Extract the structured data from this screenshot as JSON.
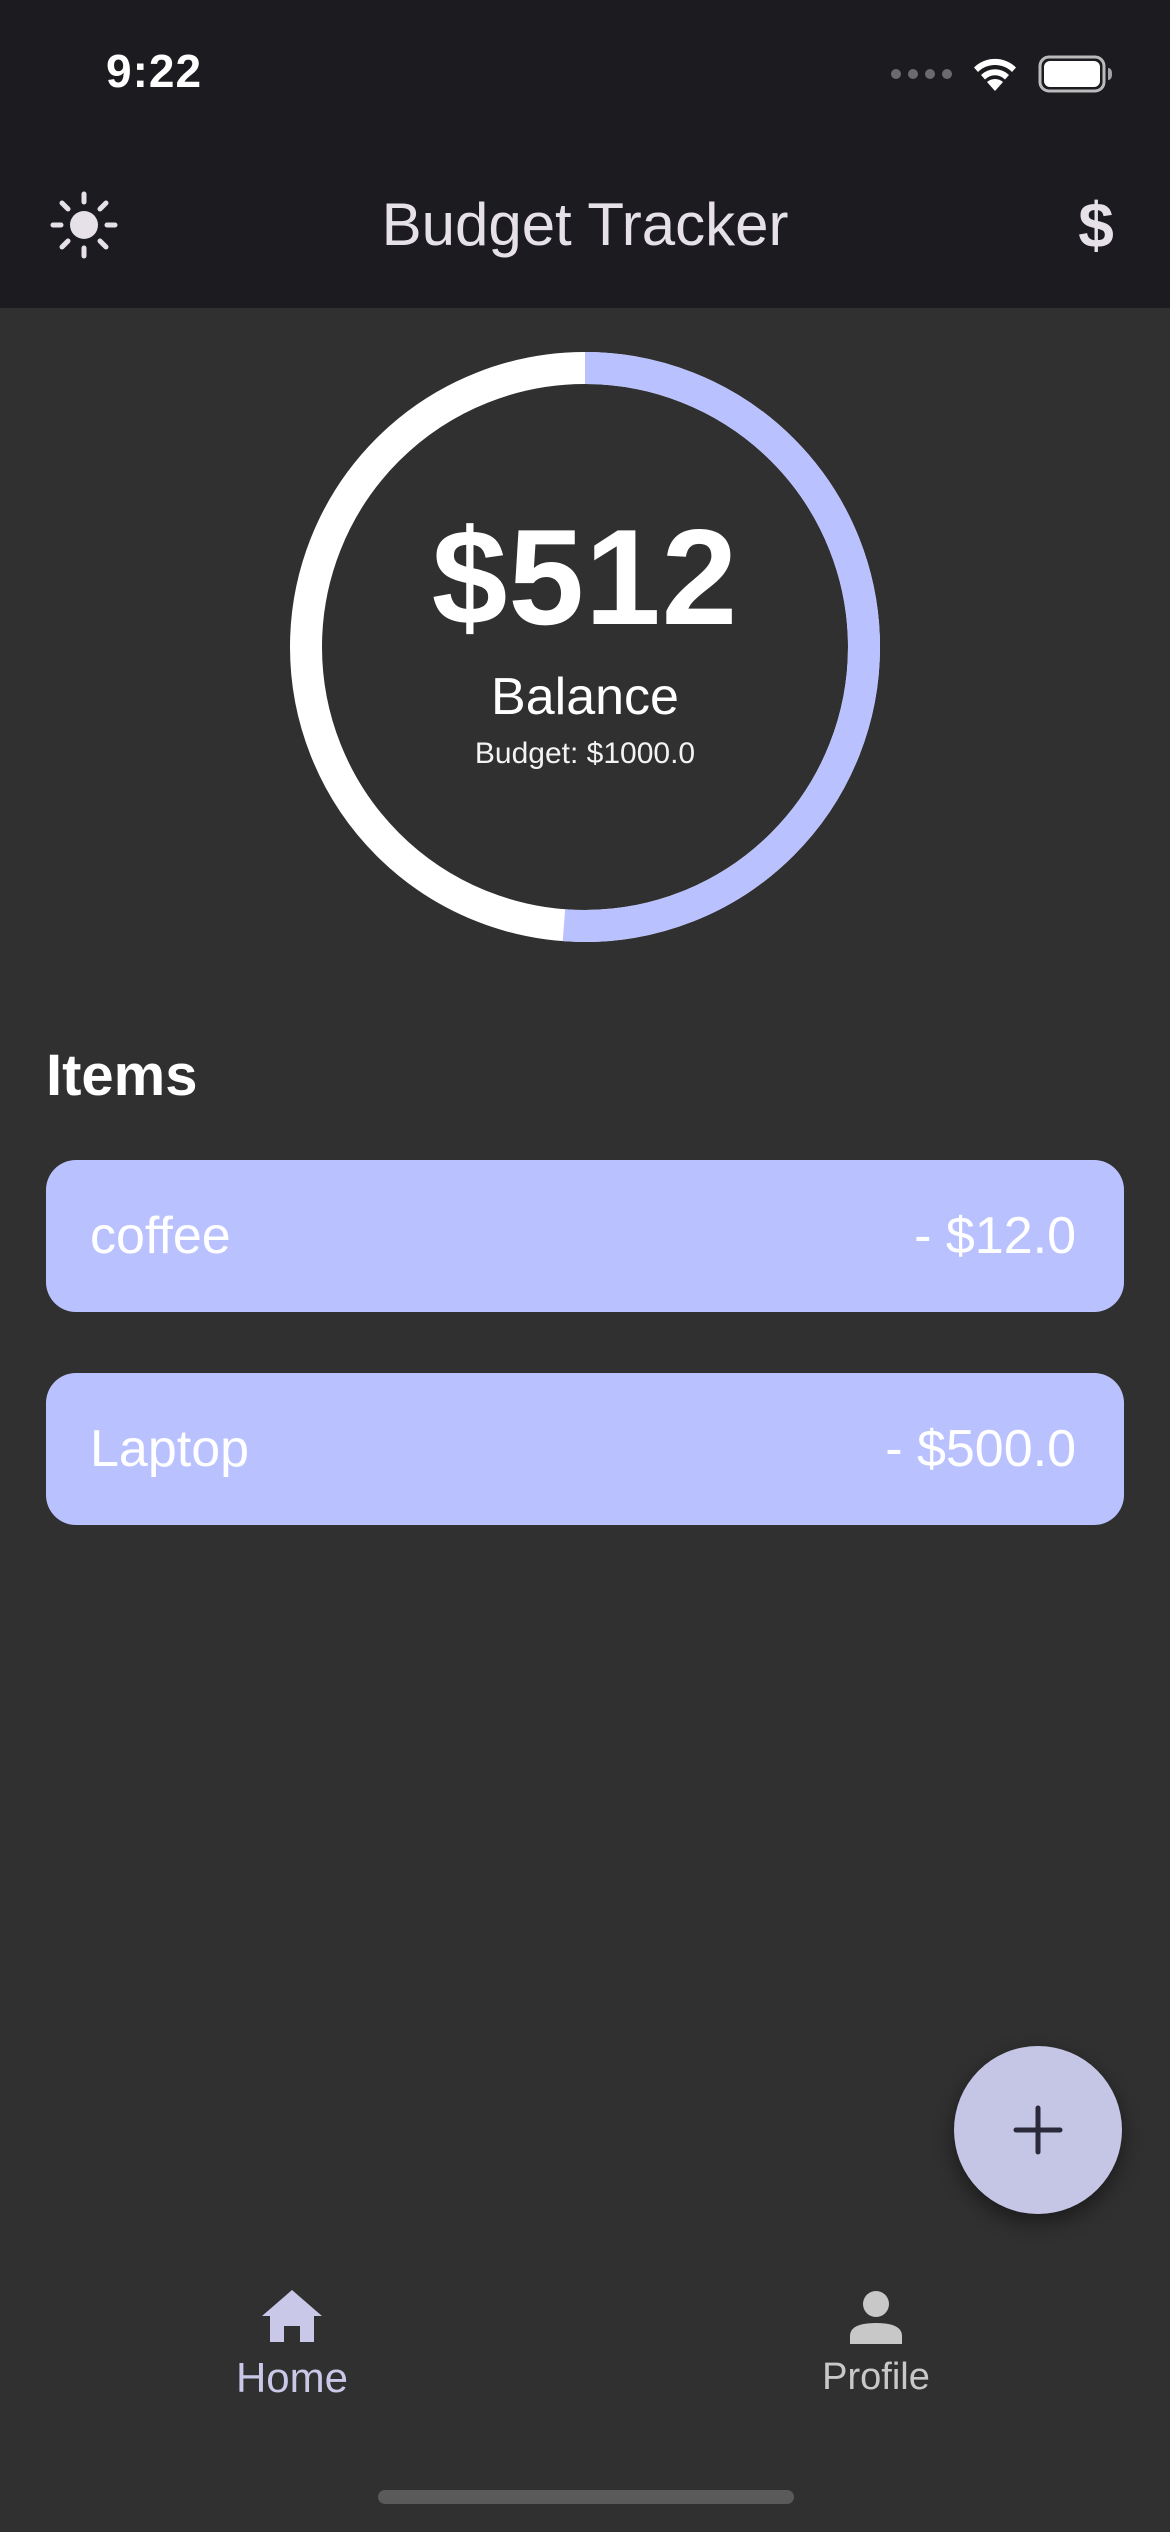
{
  "status_bar": {
    "time": "9:22"
  },
  "app_bar": {
    "title": "Budget Tracker",
    "theme_icon": "sun-icon",
    "currency_icon": "dollar-icon",
    "currency_symbol": "$"
  },
  "summary": {
    "balance": "$512",
    "balance_label": "Balance",
    "budget_text": "Budget: $1000.0",
    "spent_fraction": 0.512
  },
  "items_section": {
    "heading": "Items",
    "items": [
      {
        "name": "coffee",
        "amount": "- $12.0"
      },
      {
        "name": "Laptop",
        "amount": "- $500.0"
      }
    ]
  },
  "fab": {
    "icon": "plus-icon"
  },
  "bottom_nav": {
    "items": [
      {
        "label": "Home",
        "icon": "home-icon",
        "active": true
      },
      {
        "label": "Profile",
        "icon": "person-icon",
        "active": false
      }
    ]
  },
  "colors": {
    "background": "#303030",
    "app_bar": "#1c1b20",
    "accent": "#b9c2ff",
    "fab": "#c5c6e6",
    "gauge_track": "#ffffff"
  }
}
